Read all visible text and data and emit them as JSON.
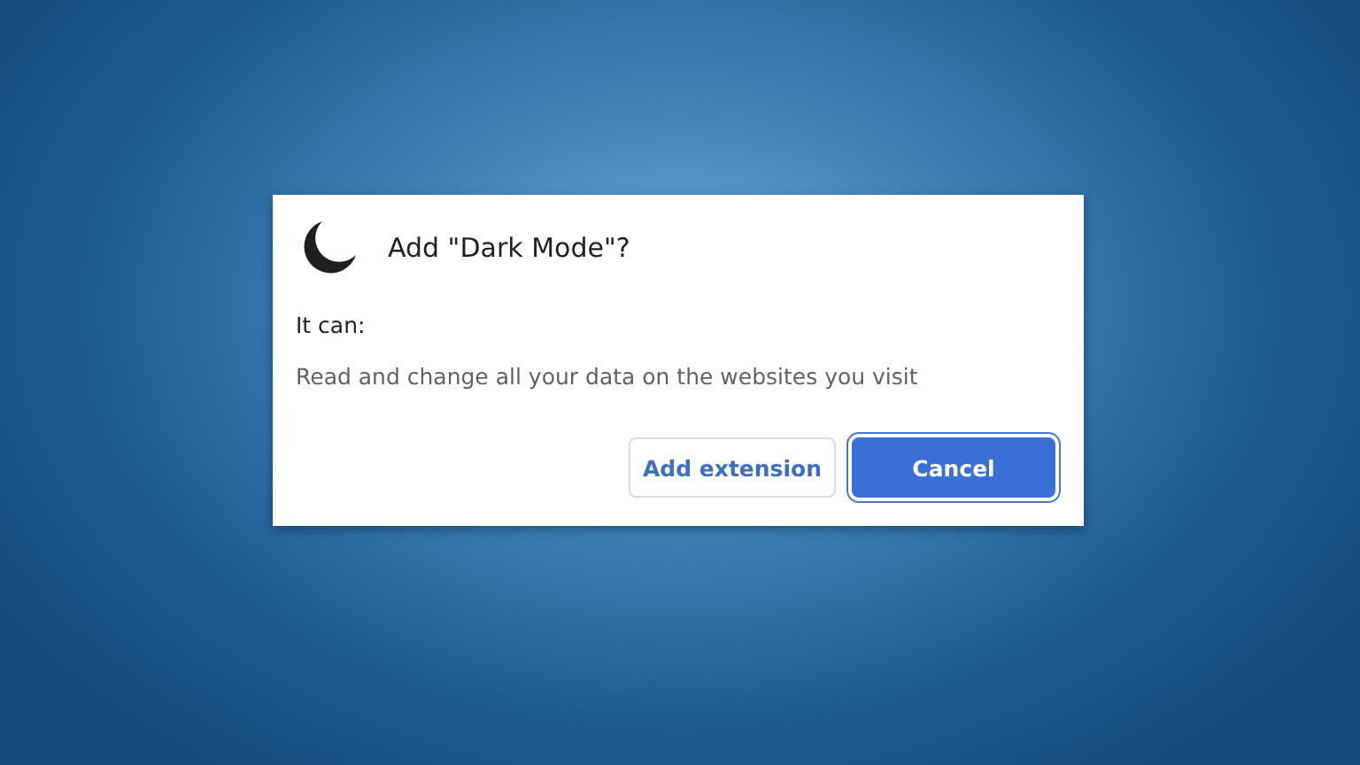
{
  "dialog": {
    "title": "Add \"Dark Mode\"?",
    "intro": "It can:",
    "permissions": [
      "Read and change all your data on the websites you visit"
    ],
    "buttons": [
      {
        "label": "Add extension",
        "kind": "secondary",
        "focused": false
      },
      {
        "label": "Cancel",
        "kind": "primary",
        "focused": true
      }
    ]
  }
}
